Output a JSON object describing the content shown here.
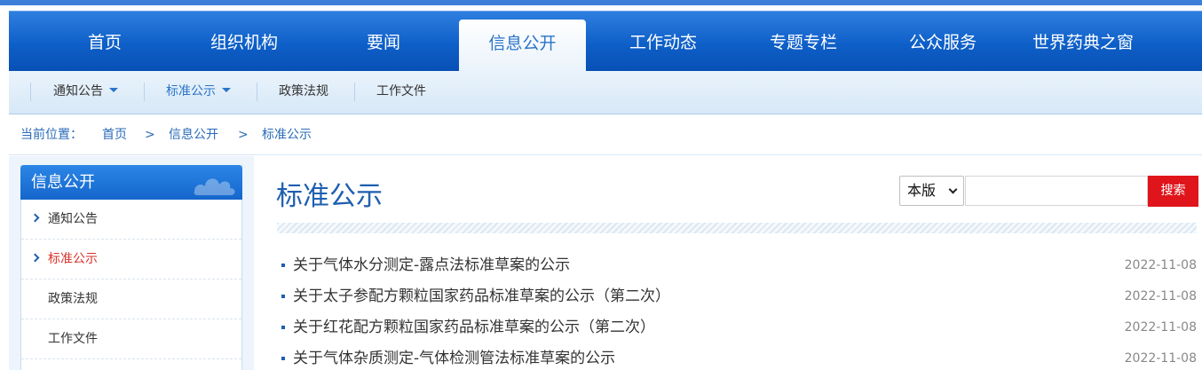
{
  "main_nav": {
    "items": [
      {
        "label": "首页"
      },
      {
        "label": "组织机构"
      },
      {
        "label": "要闻"
      },
      {
        "label": "信息公开"
      },
      {
        "label": "工作动态"
      },
      {
        "label": "专题专栏"
      },
      {
        "label": "公众服务"
      },
      {
        "label": "世界药典之窗"
      }
    ],
    "active": "信息公开"
  },
  "sub_nav": {
    "items": [
      {
        "label": "通知公告"
      },
      {
        "label": "标准公示"
      },
      {
        "label": "政策法规"
      },
      {
        "label": "工作文件"
      }
    ]
  },
  "breadcrumb": {
    "prefix": "当前位置：",
    "items": [
      "首页",
      "信息公开",
      "标准公示"
    ],
    "separator": ">"
  },
  "sidebar": {
    "title": "信息公开",
    "items": [
      {
        "label": "通知公告"
      },
      {
        "label": "标准公示"
      },
      {
        "label": "政策法规"
      },
      {
        "label": "工作文件"
      }
    ]
  },
  "content": {
    "title": "标准公示",
    "search": {
      "scope": "本版",
      "button": "搜索",
      "value": ""
    },
    "news": [
      {
        "title": "关于气体水分测定-露点法标准草案的公示",
        "date": "2022-11-08"
      },
      {
        "title": "关于太子参配方颗粒国家药品标准草案的公示（第二次）",
        "date": "2022-11-08"
      },
      {
        "title": "关于红花配方颗粒国家药品标准草案的公示（第二次）",
        "date": "2022-11-08"
      },
      {
        "title": "关于气体杂质测定-气体检测管法标准草案的公示",
        "date": "2022-11-08"
      }
    ]
  },
  "colors": {
    "nav_blue": "#0e5fc8",
    "link_blue": "#1d5fb0",
    "active_red": "#d9322c",
    "search_red": "#e0151b"
  }
}
